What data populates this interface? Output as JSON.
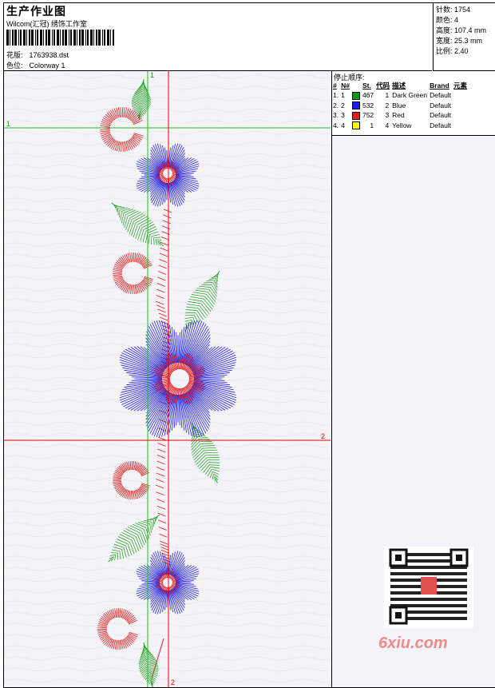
{
  "header": {
    "title": "生产作业图",
    "subtitle": "Wilcom(汇冠) 绣饰工作室",
    "pattern_label": "花版:",
    "pattern_value": "1763938.dst",
    "colorway_label": "色位:",
    "colorway_value": "Colorway 1"
  },
  "stats": {
    "stitches": "针数: 1754",
    "colors": "颜色: 4",
    "height": "高度: 107.4 mm",
    "width": "宽度: 25.3 mm",
    "scale": "比例: 2.40"
  },
  "stop_sequence": {
    "title": "停止顺序:",
    "headers": [
      "#",
      "N#",
      "St.",
      "代码",
      "描述",
      "Brand",
      "元素"
    ],
    "rows": [
      {
        "idx": "1.",
        "n": "1",
        "st": "467",
        "code": "1",
        "desc": "Dark Green",
        "brand": "Default",
        "color": "#0a9a0a"
      },
      {
        "idx": "2.",
        "n": "2",
        "st": "532",
        "code": "2",
        "desc": "Blue",
        "brand": "Default",
        "color": "#1a1aee"
      },
      {
        "idx": "3.",
        "n": "3",
        "st": "752",
        "code": "3",
        "desc": "Red",
        "brand": "Default",
        "color": "#ee1a1a"
      },
      {
        "idx": "4.",
        "n": "4",
        "st": "1",
        "code": "4",
        "desc": "Yellow",
        "brand": "Default",
        "color": "#ffff00"
      }
    ]
  },
  "guides": {
    "h1": "1",
    "h2": "2",
    "v1": "1",
    "v2": "2"
  },
  "watermark": "6xiu.com",
  "thread_colors": {
    "green": "#1a9a1a",
    "blue": "#1f1fe0",
    "red": "#e01a1a",
    "guide_red": "#e00000",
    "guide_green": "#22bb22"
  }
}
